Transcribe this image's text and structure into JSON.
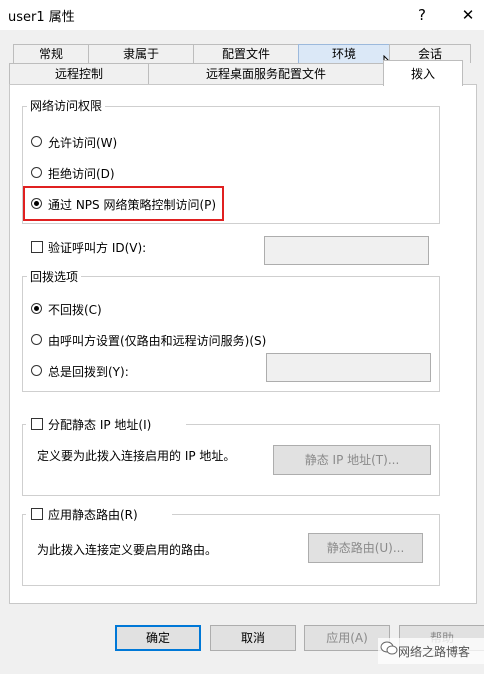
{
  "window": {
    "title": "user1 属性",
    "help_glyph": "?",
    "close_glyph": "✕"
  },
  "tabs_row1": [
    "常规",
    "隶属于",
    "配置文件",
    "环境",
    "会话"
  ],
  "tabs_row2": [
    "远程控制",
    "远程桌面服务配置文件",
    "拨入"
  ],
  "network_access": {
    "legend": "网络访问权限",
    "allow": "允许访问(W)",
    "deny": "拒绝访问(D)",
    "nps": "通过 NPS 网络策略控制访问(P)",
    "selected": "nps"
  },
  "verify_caller": {
    "label": "验证呼叫方 ID(V):",
    "checked": false,
    "value": ""
  },
  "callback": {
    "legend": "回拨选项",
    "none": "不回拨(C)",
    "set_by_caller": "由呼叫方设置(仅路由和远程访问服务)(S)",
    "always": "总是回拨到(Y):",
    "selected": "none",
    "number": ""
  },
  "static_ip": {
    "checkbox_label": "分配静态 IP 地址(I)",
    "description": "定义要为此拨入连接启用的 IP 地址。",
    "button": "静态 IP 地址(T)...",
    "checked": false
  },
  "static_routes": {
    "checkbox_label": "应用静态路由(R)",
    "description": "为此拨入连接定义要启用的路由。",
    "button": "静态路由(U)...",
    "checked": false
  },
  "footer": {
    "ok": "确定",
    "cancel": "取消",
    "apply": "应用(A)",
    "help": "帮助"
  },
  "watermark": "网络之路博客",
  "colors": {
    "highlight": "#e02020",
    "default_button_border": "#0078d7",
    "hover_tab": "#dbe8f7"
  }
}
